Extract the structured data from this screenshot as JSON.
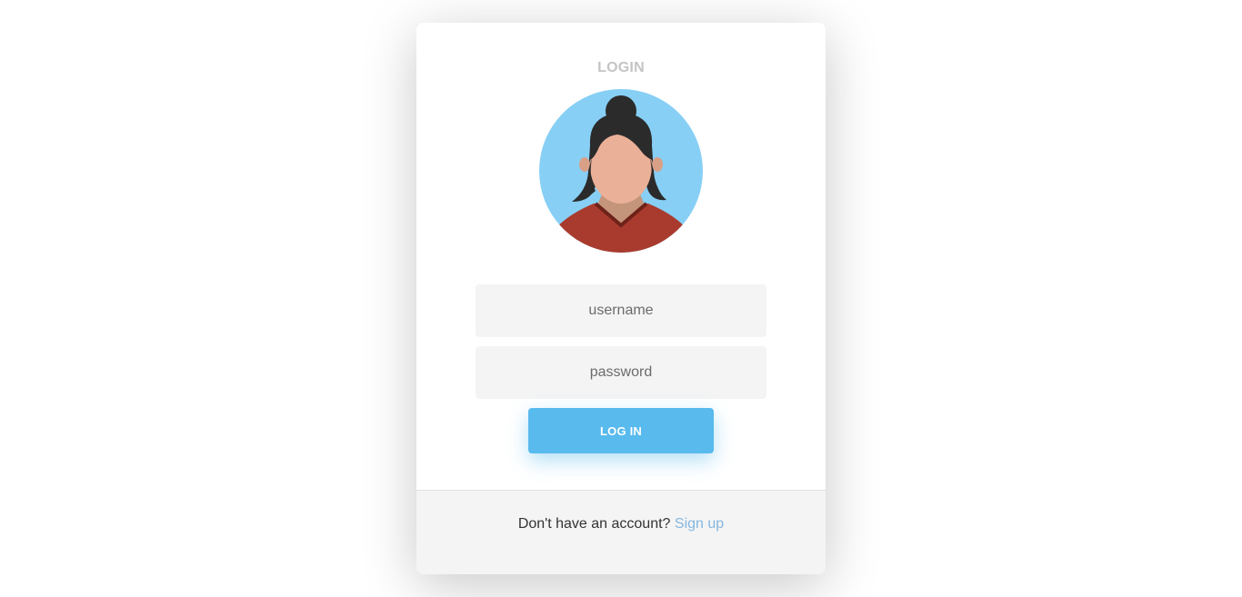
{
  "login": {
    "title": "LOGIN",
    "username_placeholder": "username",
    "password_placeholder": "password",
    "button_label": "LOG IN"
  },
  "footer": {
    "prompt": "Don't have an account?",
    "signup_link": "Sign up"
  },
  "colors": {
    "accent": "#58baed",
    "link": "#85b7e0",
    "avatar_background": "#87cff5"
  },
  "icons": {
    "avatar": "user-avatar-woman"
  }
}
